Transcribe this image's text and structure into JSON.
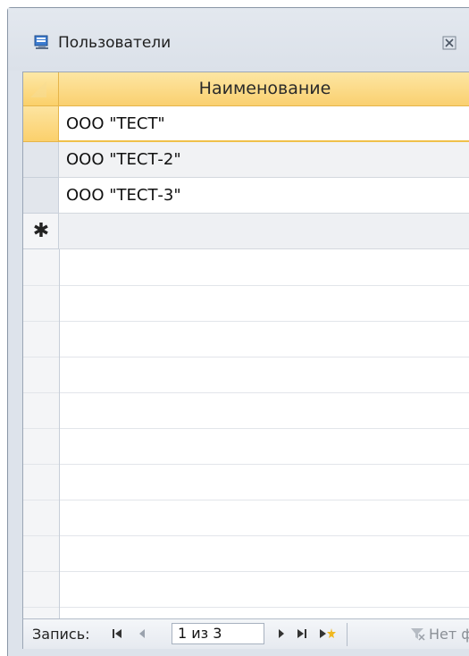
{
  "window": {
    "title": "Пользователи"
  },
  "table": {
    "column_header": "Наименование",
    "rows": [
      {
        "name": "ООО \"ТЕСТ\""
      },
      {
        "name": "ООО \"ТЕСТ-2\""
      },
      {
        "name": "ООО \"ТЕСТ-3\""
      }
    ],
    "new_row_marker": "✱"
  },
  "navigation": {
    "record_label": "Запись:",
    "record_position": "1 из 3",
    "filter_status": "Нет ф"
  },
  "colors": {
    "accent": "#fbd06c",
    "window_bg": "#dde3eb"
  }
}
